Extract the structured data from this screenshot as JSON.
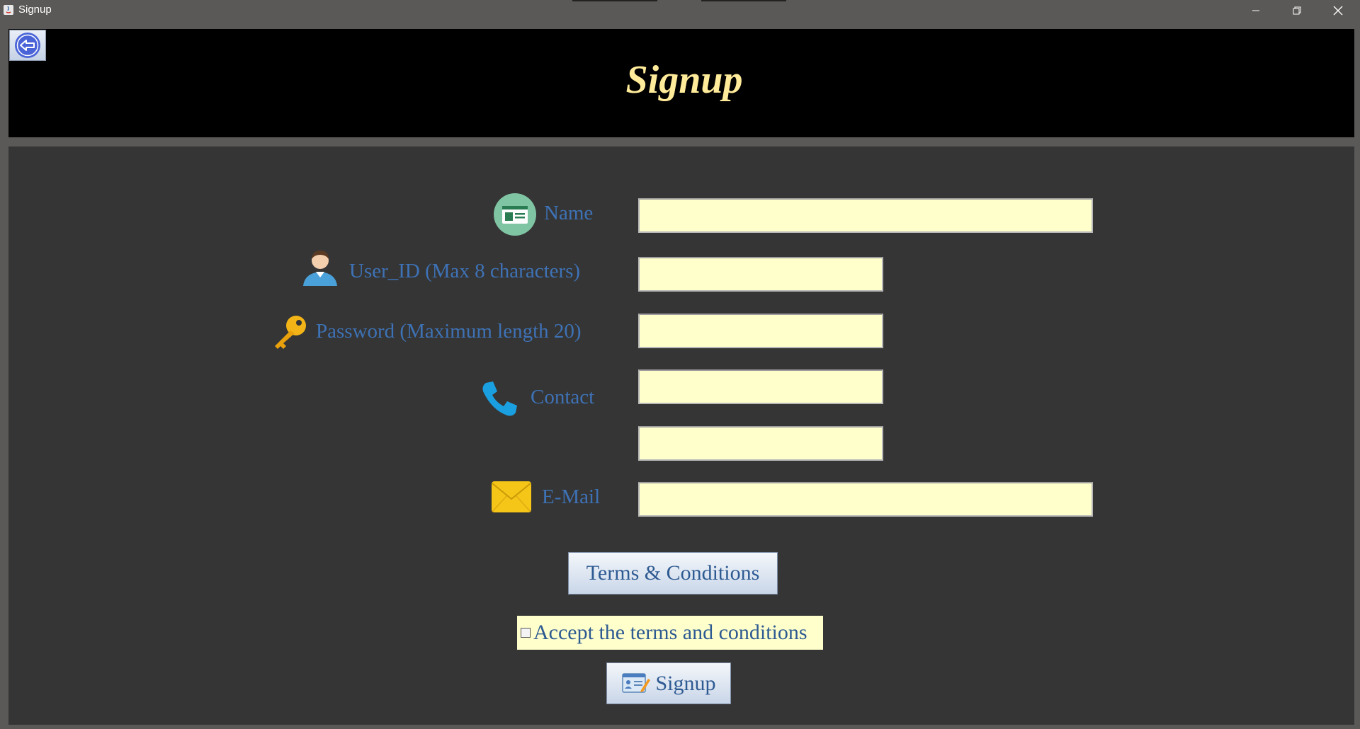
{
  "window": {
    "title": "Signup",
    "controls": [
      "minimize",
      "restore",
      "close"
    ]
  },
  "header": {
    "title": "Signup",
    "back_icon": "back-arrow-icon"
  },
  "form": {
    "name_label": "Name",
    "user_id_label": "User_ID (Max 8 characters)",
    "password_label": "Password (Maximum length 20)",
    "contact_label": "Contact",
    "email_label": "E-Mail",
    "name_value": "",
    "user_id_value": "",
    "password_value": "",
    "contact1_value": "",
    "contact2_value": "",
    "email_value": ""
  },
  "actions": {
    "terms_label": "Terms & Conditions",
    "accept_label": "Accept the terms and conditions",
    "accept_checked": false,
    "signup_label": "Signup"
  },
  "colors": {
    "header_bg": "#000000",
    "title_color": "#ffeb99",
    "panel_bg": "#353535",
    "label_color": "#3e72b6",
    "field_bg": "#ffffcc"
  }
}
